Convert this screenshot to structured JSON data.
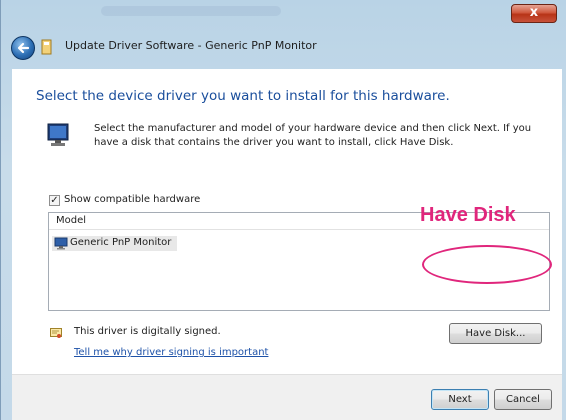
{
  "window": {
    "title": "Update Driver Software - Generic PnP Monitor",
    "close_glyph": "x"
  },
  "page": {
    "heading": "Select the device driver you want to install for this hardware.",
    "description": "Select the manufacturer and model of your hardware device and then click Next. If you have a disk that contains the driver you want to install, click Have Disk.",
    "show_compatible": {
      "label": "Show compatible hardware",
      "checked": true,
      "glyph": "✓"
    },
    "list": {
      "column_header": "Model",
      "items": [
        {
          "label": "Generic PnP Monitor",
          "selected": true,
          "icon": "monitor-icon"
        }
      ]
    },
    "signed_status": "This driver is digitally signed.",
    "signing_link": "Tell me why driver signing is important",
    "have_disk_label": "Have Disk..."
  },
  "annotation": {
    "text": "Have Disk",
    "color": "#e0267c"
  },
  "footer": {
    "next_label": "Next",
    "cancel_label": "Cancel"
  },
  "colors": {
    "heading": "#1a4e9c",
    "link": "#1e52a8",
    "frame": "#c4d9e9"
  }
}
